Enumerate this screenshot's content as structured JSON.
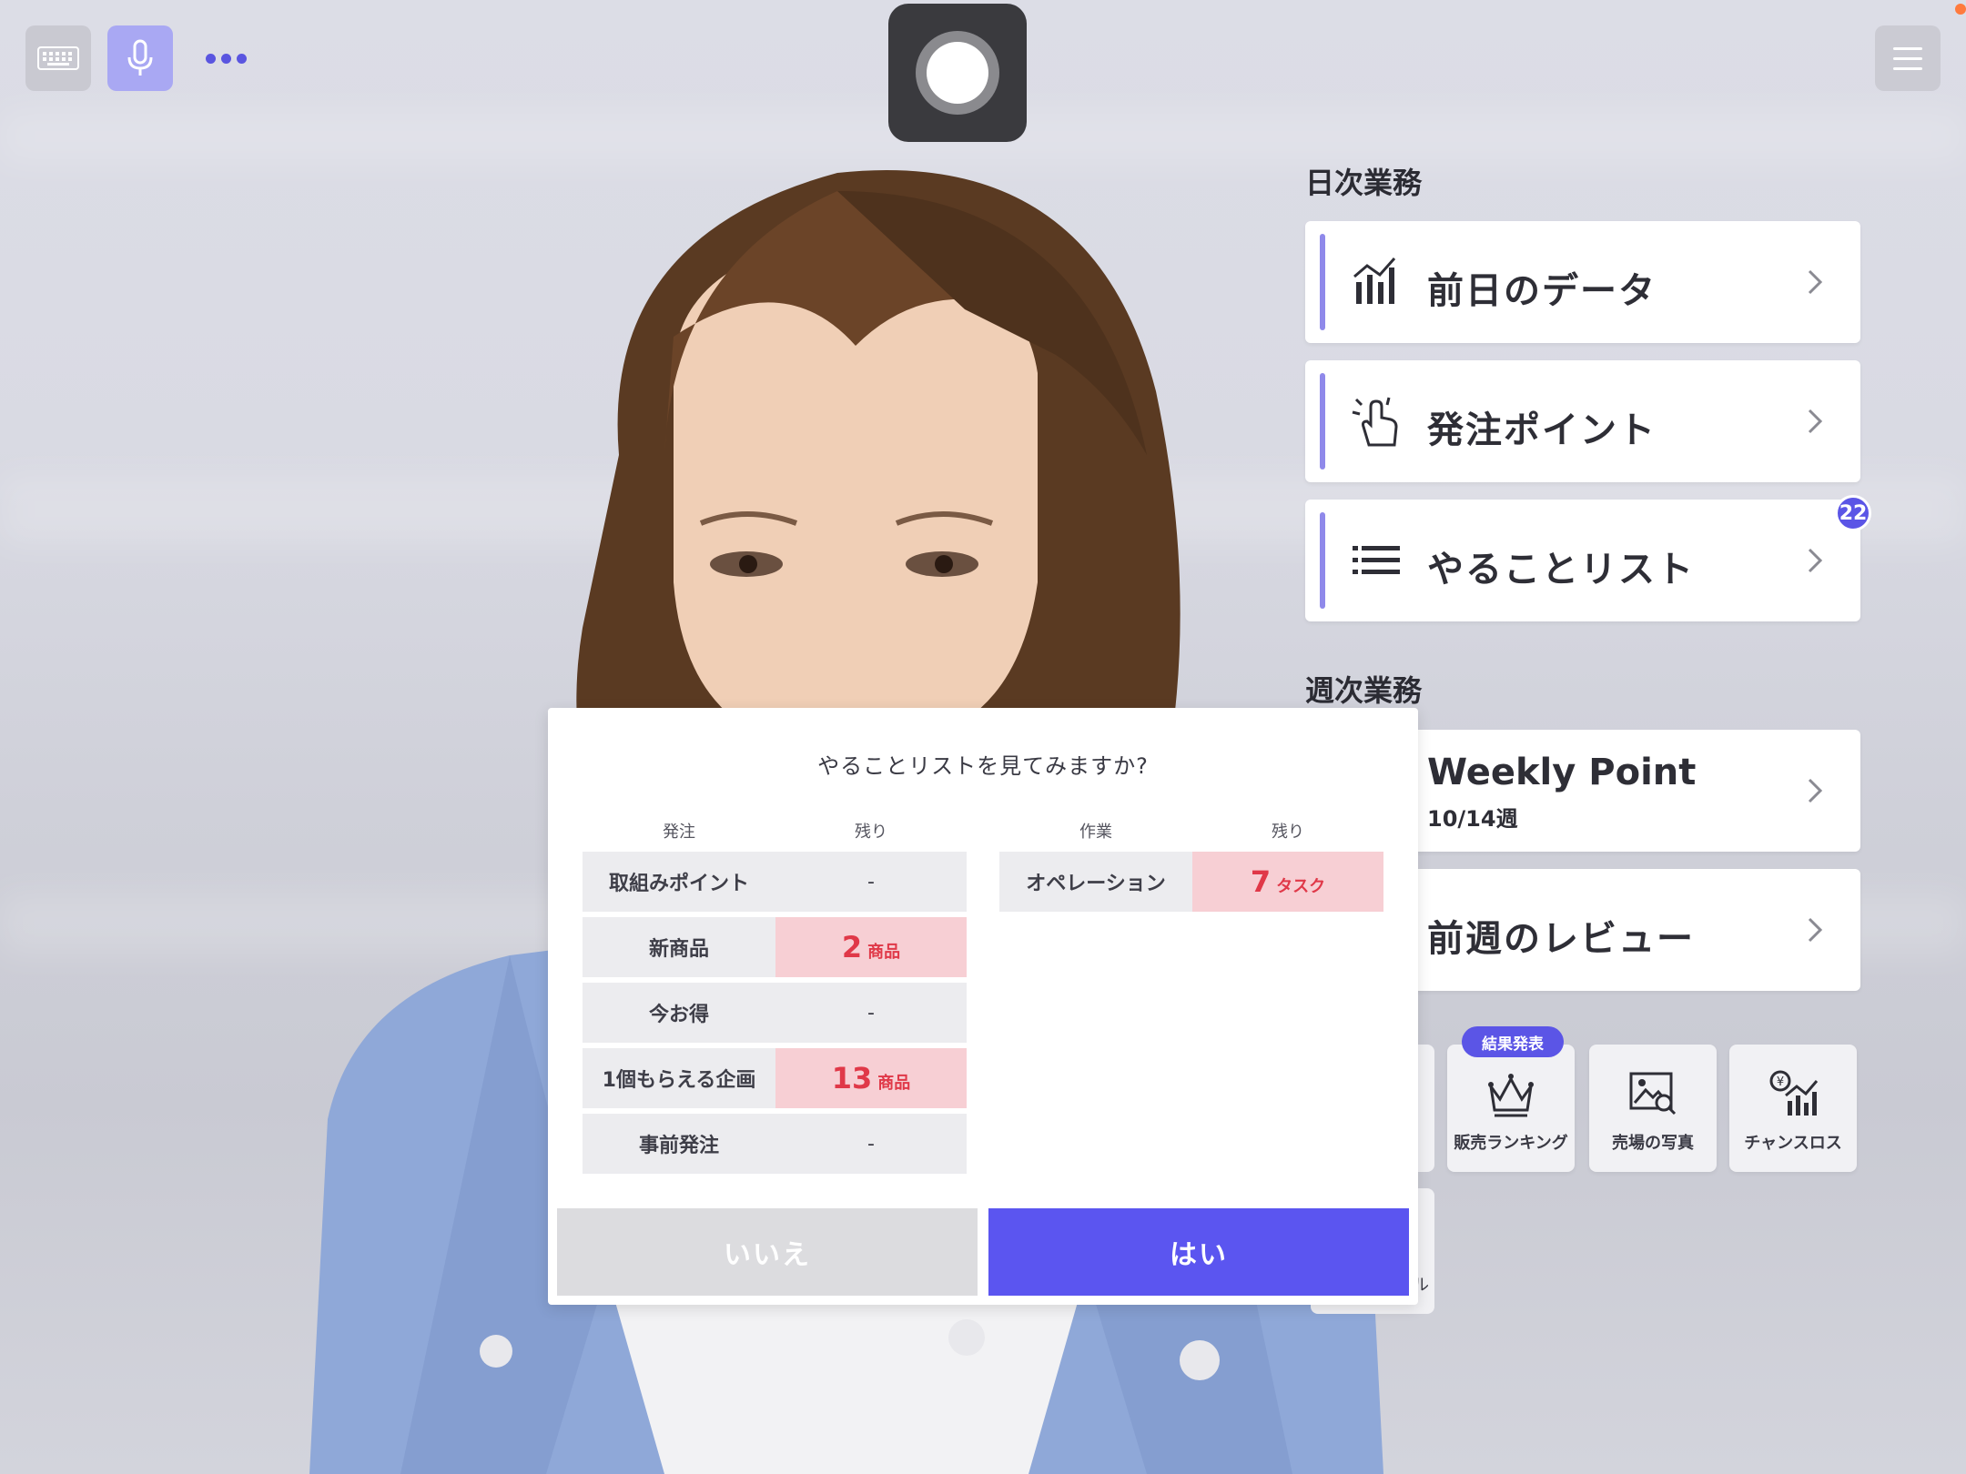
{
  "toolbar": {
    "keyboard_icon": "keyboard-icon",
    "mic_icon": "microphone-icon",
    "more_icon": "more-dots-icon",
    "record_icon": "record-button-icon",
    "menu_icon": "hamburger-menu-icon"
  },
  "daily": {
    "title": "日次業務",
    "items": [
      {
        "label": "前日のデータ",
        "icon": "bar-chart-icon"
      },
      {
        "label": "発注ポイント",
        "icon": "hand-tap-icon"
      },
      {
        "label": "やることリスト",
        "icon": "list-icon",
        "badge": "22"
      }
    ]
  },
  "weekly": {
    "title": "週次業務",
    "items": [
      {
        "label": "Weekly Point",
        "sub": "10/14週"
      },
      {
        "label": "前週のレビュー"
      }
    ]
  },
  "tiles": {
    "badge": "結果発表",
    "items": [
      {
        "label": "販売ランキング",
        "icon": "crown-icon"
      },
      {
        "label": "売場の写真",
        "icon": "photo-search-icon"
      },
      {
        "label": "チャンスロス",
        "icon": "yen-chart-icon"
      }
    ],
    "partial_text": "ル"
  },
  "dialog": {
    "question": "やることリストを見てみますか?",
    "order_head": "発注",
    "remain_head": "残り",
    "work_head": "作業",
    "remain_head2": "残り",
    "order_rows": [
      {
        "label": "取組みポイント",
        "value": "-"
      },
      {
        "label": "新商品",
        "num": "2",
        "unit": "商品"
      },
      {
        "label": "今お得",
        "value": "-"
      },
      {
        "label": "1個もらえる企画",
        "num": "13",
        "unit": "商品"
      },
      {
        "label": "事前発注",
        "value": "-"
      }
    ],
    "work_rows": [
      {
        "label": "オペレーション",
        "num": "7",
        "unit": "タスク"
      }
    ],
    "no_label": "いいえ",
    "yes_label": "はい"
  },
  "colors": {
    "accent": "#5b55f0",
    "highlight_bg": "#f7cfd4",
    "highlight_text": "#e03848"
  }
}
